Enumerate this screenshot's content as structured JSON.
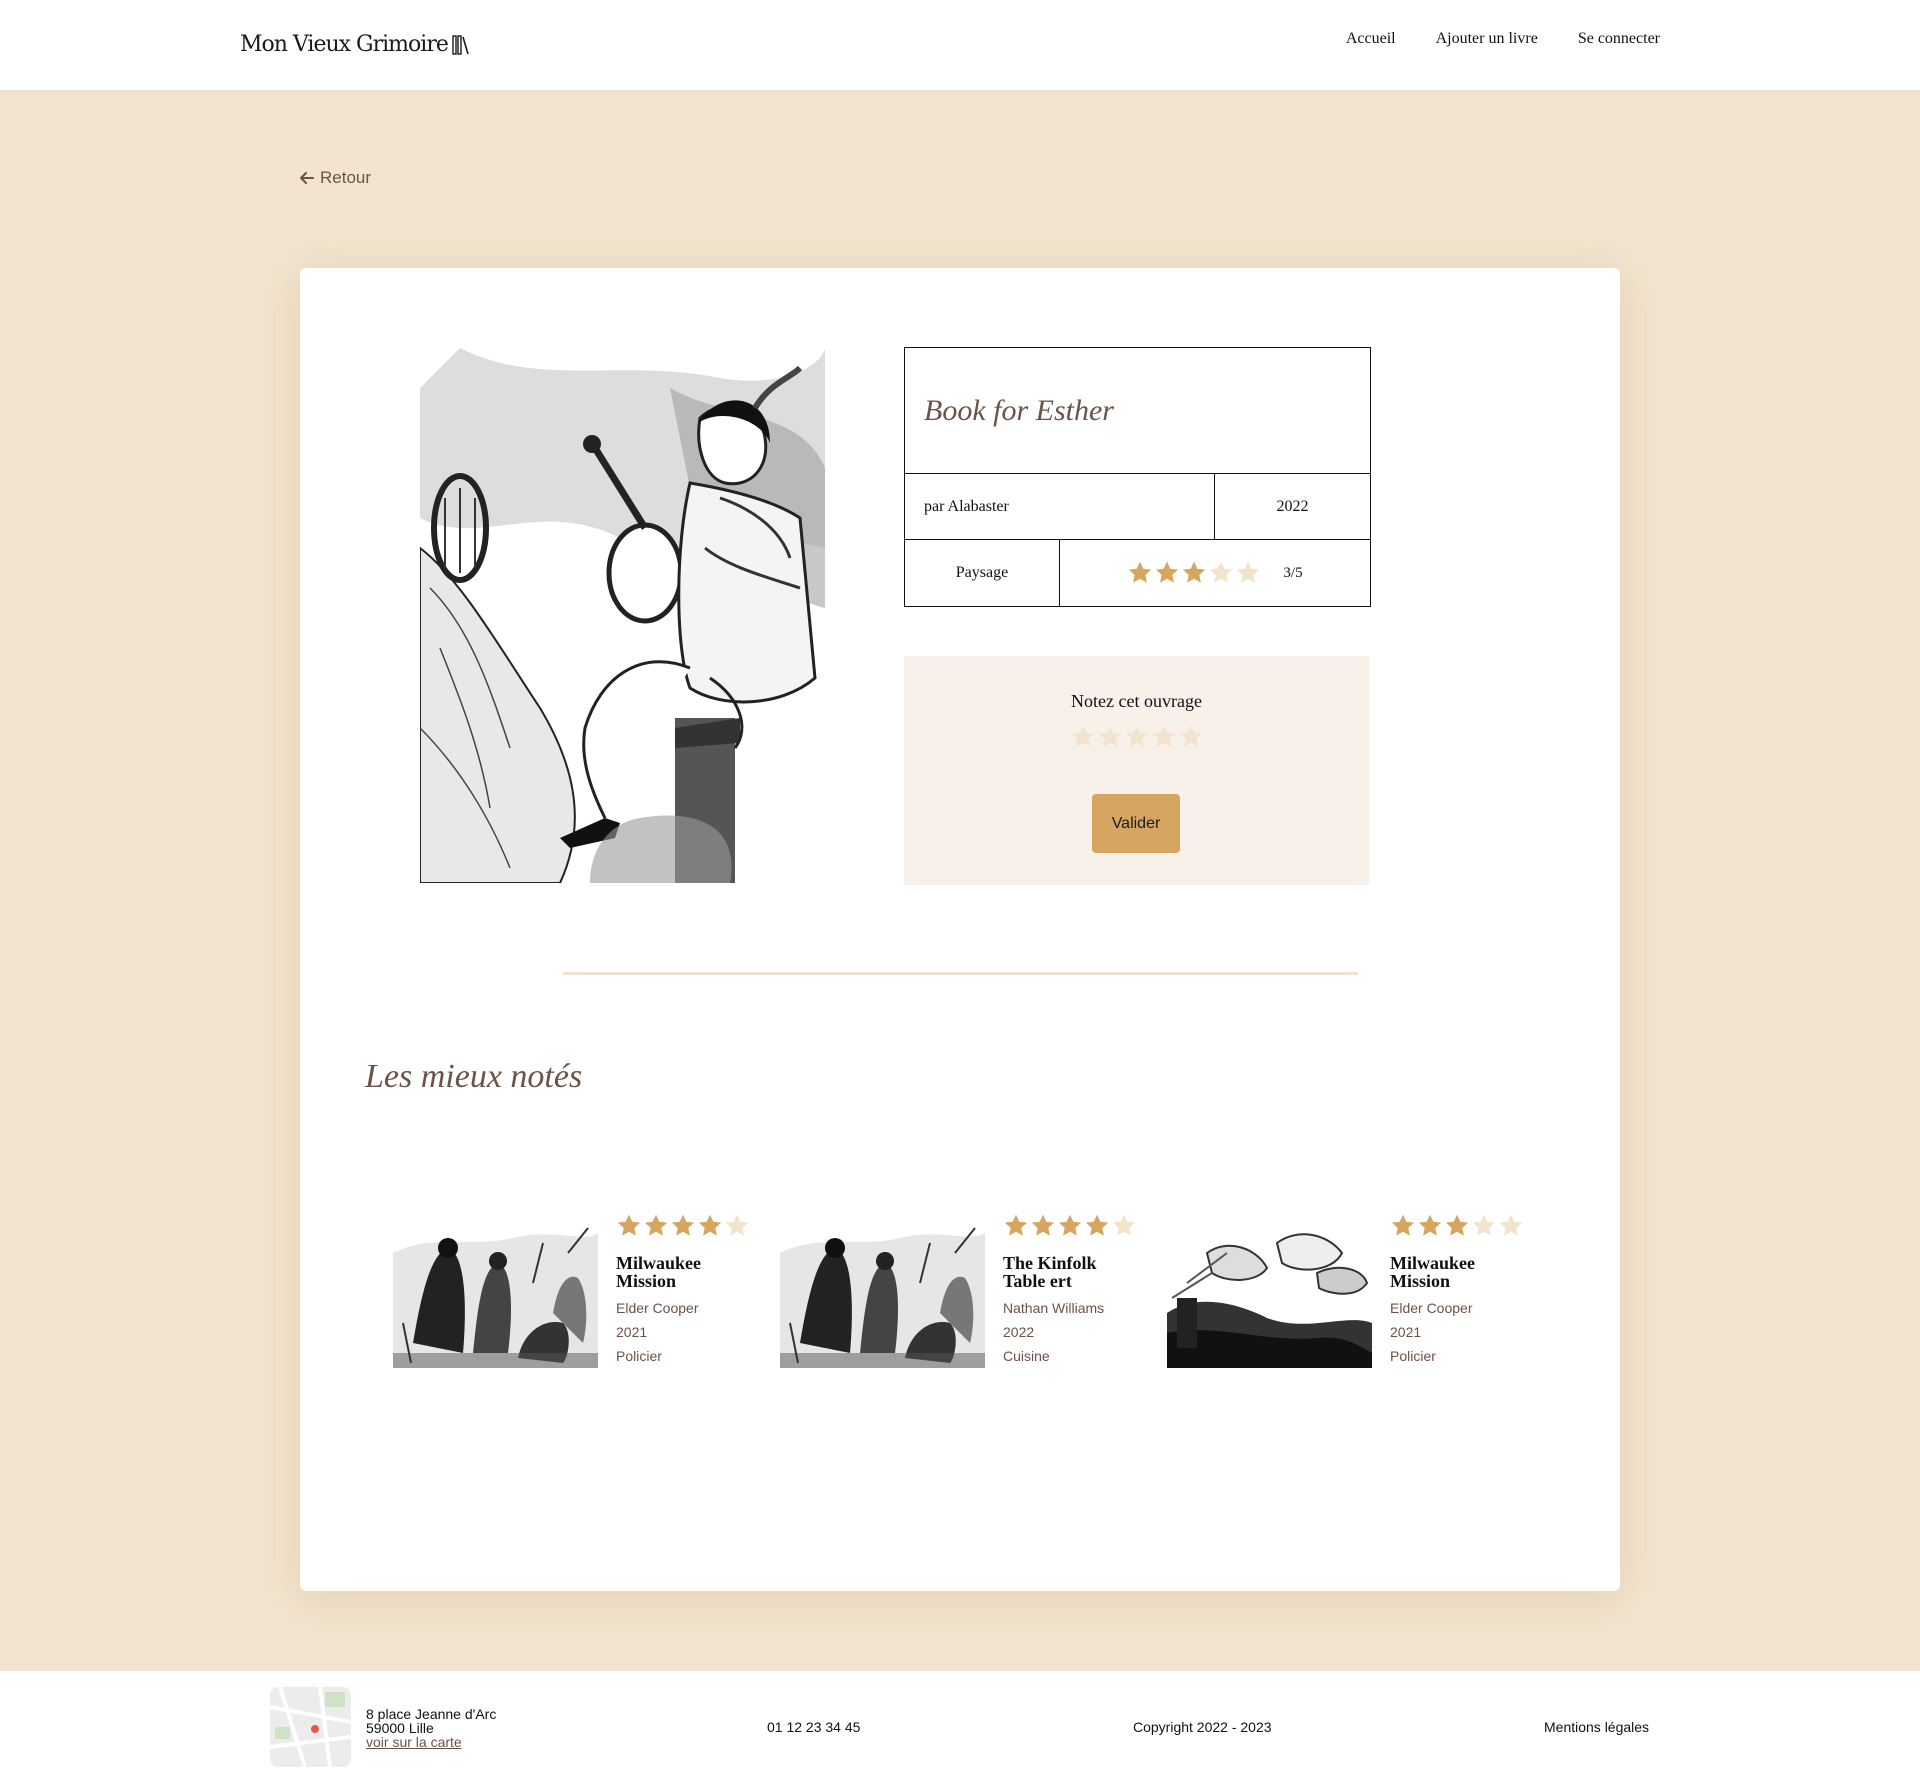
{
  "header": {
    "logo": "Mon Vieux Grimoire",
    "nav": [
      "Accueil",
      "Ajouter un livre",
      "Se connecter"
    ]
  },
  "back_label": "Retour",
  "book": {
    "title": "Book for Esther",
    "author": "par Alabaster",
    "year": "2022",
    "genre": "Paysage",
    "rating": 3,
    "rating_label": "3/5"
  },
  "rate": {
    "title": "Notez cet ouvrage",
    "rating": 0,
    "button": "Valider"
  },
  "top_rated": {
    "title": "Les mieux notés",
    "books": [
      {
        "title": "Milwaukee Mission",
        "author": "Elder Cooper",
        "year": "2021",
        "genre": "Policier",
        "rating": 4
      },
      {
        "title": "The Kinfolk Table ert",
        "author": "Nathan Williams",
        "year": "2022",
        "genre": "Cuisine",
        "rating": 4
      },
      {
        "title": "Milwaukee Mission",
        "author": "Elder Cooper",
        "year": "2021",
        "genre": "Policier",
        "rating": 3
      }
    ]
  },
  "footer": {
    "address_line1": "8 place Jeanne d'Arc",
    "address_line2": "59000 Lille",
    "map_link": "voir sur la carte",
    "phone": "01 12 23 34 45",
    "copyright": "Copyright 2022 - 2023",
    "legal": "Mentions légales"
  },
  "colors": {
    "background": "#f2e4cf",
    "accent": "#d6a660",
    "star_filled": "#d6a660",
    "star_empty": "#f1e3cc",
    "title_brown": "#6b5347"
  }
}
